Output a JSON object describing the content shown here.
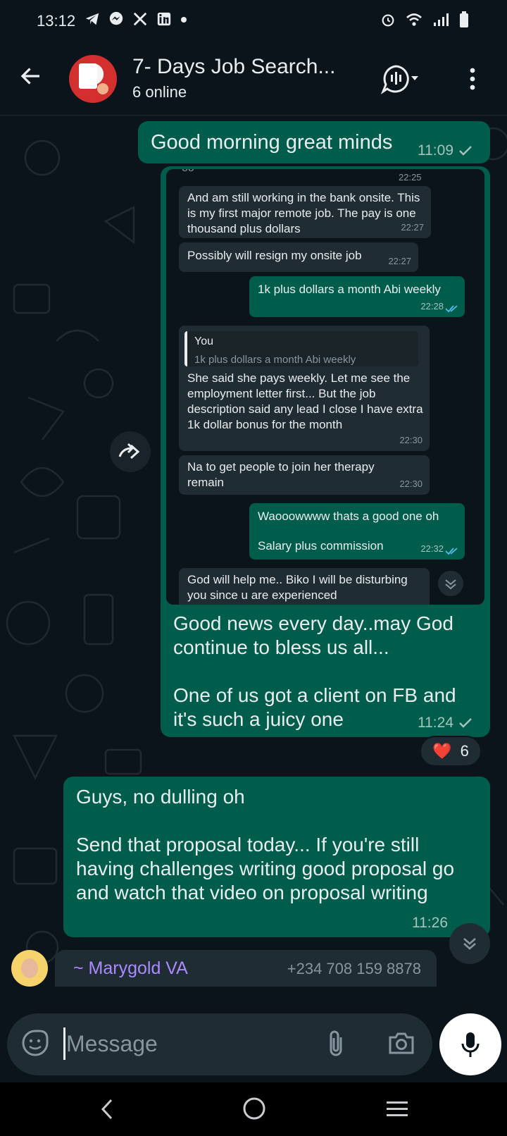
{
  "status_bar": {
    "time": "13:12",
    "left_icons": [
      "telegram-icon",
      "messenger-icon",
      "x-icon",
      "linkedin-icon",
      "dot-icon"
    ],
    "right_icons": [
      "alarm-icon",
      "wifi-icon",
      "signal-icon",
      "battery-icon"
    ]
  },
  "header": {
    "title": "7- Days Job Search...",
    "subtitle": "6 online"
  },
  "messages": {
    "m1": {
      "text": "Good morning great minds",
      "time": "11:09",
      "status": "sent"
    },
    "m2": {
      "caption": "Good news every day..may  God continue to bless us all...\n\nOne of us got a client on FB and it's such a juicy one",
      "time": "11:24",
      "reaction": {
        "emoji": "❤️",
        "count": "6"
      },
      "screenshot": {
        "t0": "22:25",
        "in1": "And am still working in the bank onsite. This is my first major remote job. The pay is one thousand plus dollars",
        "in1_time": "22:27",
        "in2": "Possibly will resign my onsite job",
        "in2_time": "22:27",
        "out1": "1k plus dollars a month Abi weekly",
        "out1_time": "22:28",
        "quote_name": "You",
        "quote_text": "1k plus dollars a month Abi weekly",
        "in3": "She said  she pays weekly. Let me see the employment letter first... But the job description said any lead I close I have extra 1k dollar bonus for the month",
        "in3_time": "22:30",
        "in4": "Na to get people to join her therapy remain",
        "in4_time": "22:30",
        "out2a": "Waooowwww thats a good one oh",
        "out2b": "Salary plus commission",
        "out2_time": "22:32",
        "in5": "God will help me.. Biko I will be disturbing you since u are experienced"
      }
    },
    "m3": {
      "text": "Guys, no dulling oh\n\nSend that proposal today... If you're still having challenges writing good proposal go and watch that video on proposal writing",
      "time": "11:26"
    },
    "incoming": {
      "sender": "~ Marygold VA",
      "phone": "+234 708 159 8878"
    }
  },
  "composer": {
    "placeholder": "Message"
  },
  "colors": {
    "bubble_out": "#005c4b",
    "bubble_in": "#202c33",
    "background": "#0b141a",
    "read_tick": "#53bdeb",
    "sender_name": "#a98bff"
  }
}
